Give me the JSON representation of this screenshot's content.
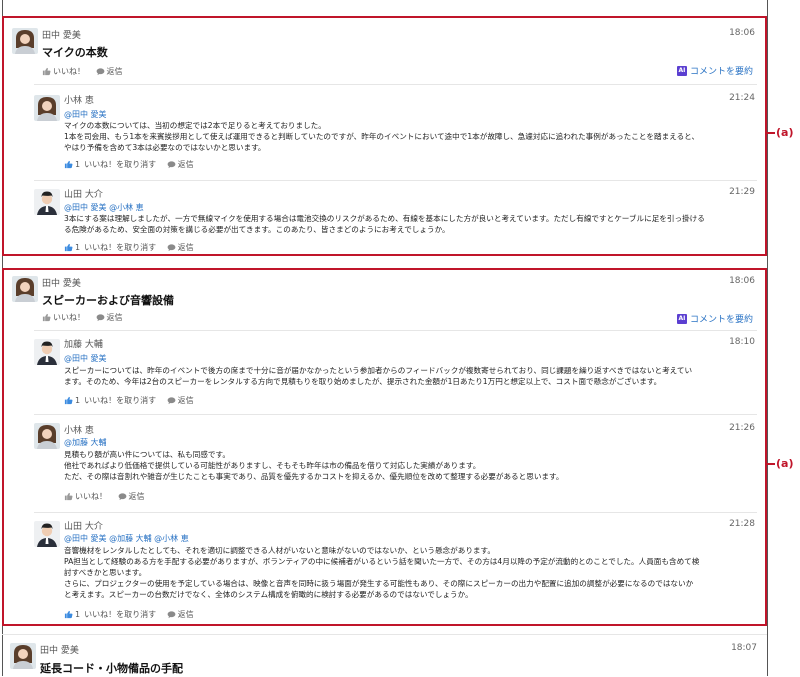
{
  "threads": [
    {
      "author": "田中 愛美",
      "time": "18:06",
      "title": "マイクの本数",
      "like_label": "いいね！",
      "reply_label": "返信",
      "summary_label": "コメントを要約",
      "marker": "(a)",
      "replies": [
        {
          "author": "小林 恵",
          "time": "21:24",
          "mentions": "@田中 愛美",
          "lines": [
            "マイクの本数については、当初の想定では2本で足りると考えておりました。",
            "1本を司会用、もう1本を来賓挨拶用として使えば運用できると判断していたのですが、昨年のイベントにおいて途中で1本が故障し、急遽対応に追われた事例があったことを踏まえると、",
            "やはり予備を含めて3本は必要なのではないかと思います。"
          ],
          "like_count": "1",
          "like_label": "いいね！を取り消す",
          "reply_label": "返信"
        },
        {
          "author": "山田 大介",
          "time": "21:29",
          "mentions": "@田中 愛美 @小林 恵",
          "lines": [
            "3本にする案は理解しましたが、一方で無線マイクを使用する場合は電池交換のリスクがあるため、有線を基本にした方が良いと考えています。ただし有線ですとケーブルに足を引っ掛ける",
            "る危険があるため、安全面の対策を講じる必要が出てきます。このあたり、皆さまどのようにお考えでしょうか。"
          ],
          "like_count": "1",
          "like_label": "いいね！を取り消す",
          "reply_label": "返信"
        }
      ]
    },
    {
      "author": "田中 愛美",
      "time": "18:06",
      "title": "スピーカーおよび音響設備",
      "like_label": "いいね！",
      "reply_label": "返信",
      "summary_label": "コメントを要約",
      "marker": "(a)",
      "replies": [
        {
          "author": "加藤 大輔",
          "time": "18:10",
          "mentions": "@田中 愛美",
          "lines": [
            "スピーカーについては、昨年のイベントで後方の席まで十分に音が届かなかったという参加者からのフィードバックが複数寄せられており、同じ課題を繰り返すべきではないと考えてい",
            "ます。そのため、今年は2台のスピーカーをレンタルする方向で見積もりを取り始めましたが、提示された金額が1日あたり1万円と想定以上で、コスト面で懸念がございます。"
          ],
          "like_count": "1",
          "like_label": "いいね！を取り消す",
          "reply_label": "返信"
        },
        {
          "author": "小林 恵",
          "time": "21:26",
          "mentions": "@加藤 大輔",
          "lines": [
            "見積もり額が高い件については、私も同感です。",
            "他社であればより低価格で提供している可能性がありますし、そもそも昨年は市の備品を借りて対応した実績があります。",
            "ただ、その際は音割れや雑音が生じたことも事実であり、品質を優先するかコストを抑えるか、優先順位を改めて整理する必要があると思います。"
          ],
          "like_count": "",
          "like_label": "いいね！",
          "reply_label": "返信"
        },
        {
          "author": "山田 大介",
          "time": "21:28",
          "mentions": "@田中 愛美 @加藤 大輔 @小林 恵",
          "lines": [
            "音響機材をレンタルしたとしても、それを適切に調整できる人材がいないと意味がないのではないか、という懸念があります。",
            "PA担当として経験のある方を手配する必要がありますが、ボランティアの中に候補者がいるという話を聞いた一方で、その方は4月以降の予定が流動的とのことでした。人員面も含めて検",
            "討すべきかと思います。",
            "さらに、プロジェクターの使用を予定している場合は、映像と音声を同時に扱う場面が発生する可能性もあり、その際にスピーカーの出力や配置に追加の調整が必要になるのではないか",
            "と考えます。スピーカーの台数だけでなく、全体のシステム構成を俯瞰的に検討する必要があるのではないでしょうか。"
          ],
          "like_count": "1",
          "like_label": "いいね！を取り消す",
          "reply_label": "返信"
        }
      ]
    },
    {
      "author": "田中 愛美",
      "time": "18:07",
      "title": "延長コード・小物備品の手配"
    }
  ],
  "icons": {
    "like": "thumbs-up-icon",
    "reply": "speech-bubble-icon",
    "ai": "ai-badge-icon"
  },
  "colors": {
    "highlight": "#c0152a",
    "link": "#2a73c4",
    "ai": "#5b3fd1"
  }
}
